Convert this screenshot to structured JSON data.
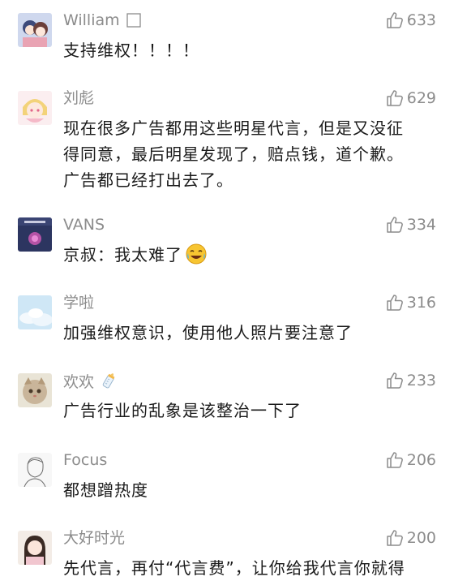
{
  "comments": [
    {
      "username": "William",
      "username_icon": "white-square-icon",
      "likes": "633",
      "lines": [
        "支持维权！！！！"
      ],
      "avatar": "anime-couple-avatar"
    },
    {
      "username": "刘彪",
      "likes": "629",
      "lines": [
        "现在很多广告都用这些明星代言，但是又没征",
        "得同意，最后明星发现了，赔点钱，道个歉。",
        "广告都已经打出去了。"
      ],
      "avatar": "anime-girl-avatar"
    },
    {
      "username": "VANS",
      "likes": "334",
      "lines": [
        "京叔：我太难了"
      ],
      "avatar": "dark-album-avatar",
      "emoji": "crying-laughing-emoji"
    },
    {
      "username": "学啦",
      "likes": "316",
      "lines": [
        "加强维权意识，使用他人照片要注意了"
      ],
      "avatar": "sky-cloud-avatar"
    },
    {
      "username": "欢欢",
      "username_icon": "baby-bottle-icon",
      "likes": "233",
      "lines": [
        "广告行业的乱象是该整治一下了"
      ],
      "avatar": "cat-avatar"
    },
    {
      "username": "Focus",
      "likes": "206",
      "lines": [
        "都想蹭热度"
      ],
      "avatar": "sketch-portrait-avatar"
    },
    {
      "username": "大好时光",
      "likes": "200",
      "lines": [
        "先代言，再付“代言费”，让你给我代言你就得"
      ],
      "avatar": "girl-photo-avatar"
    }
  ],
  "colors": {
    "meta_text": "#8c8c8c",
    "body_text": "#1a1a1a",
    "background": "#ffffff"
  }
}
